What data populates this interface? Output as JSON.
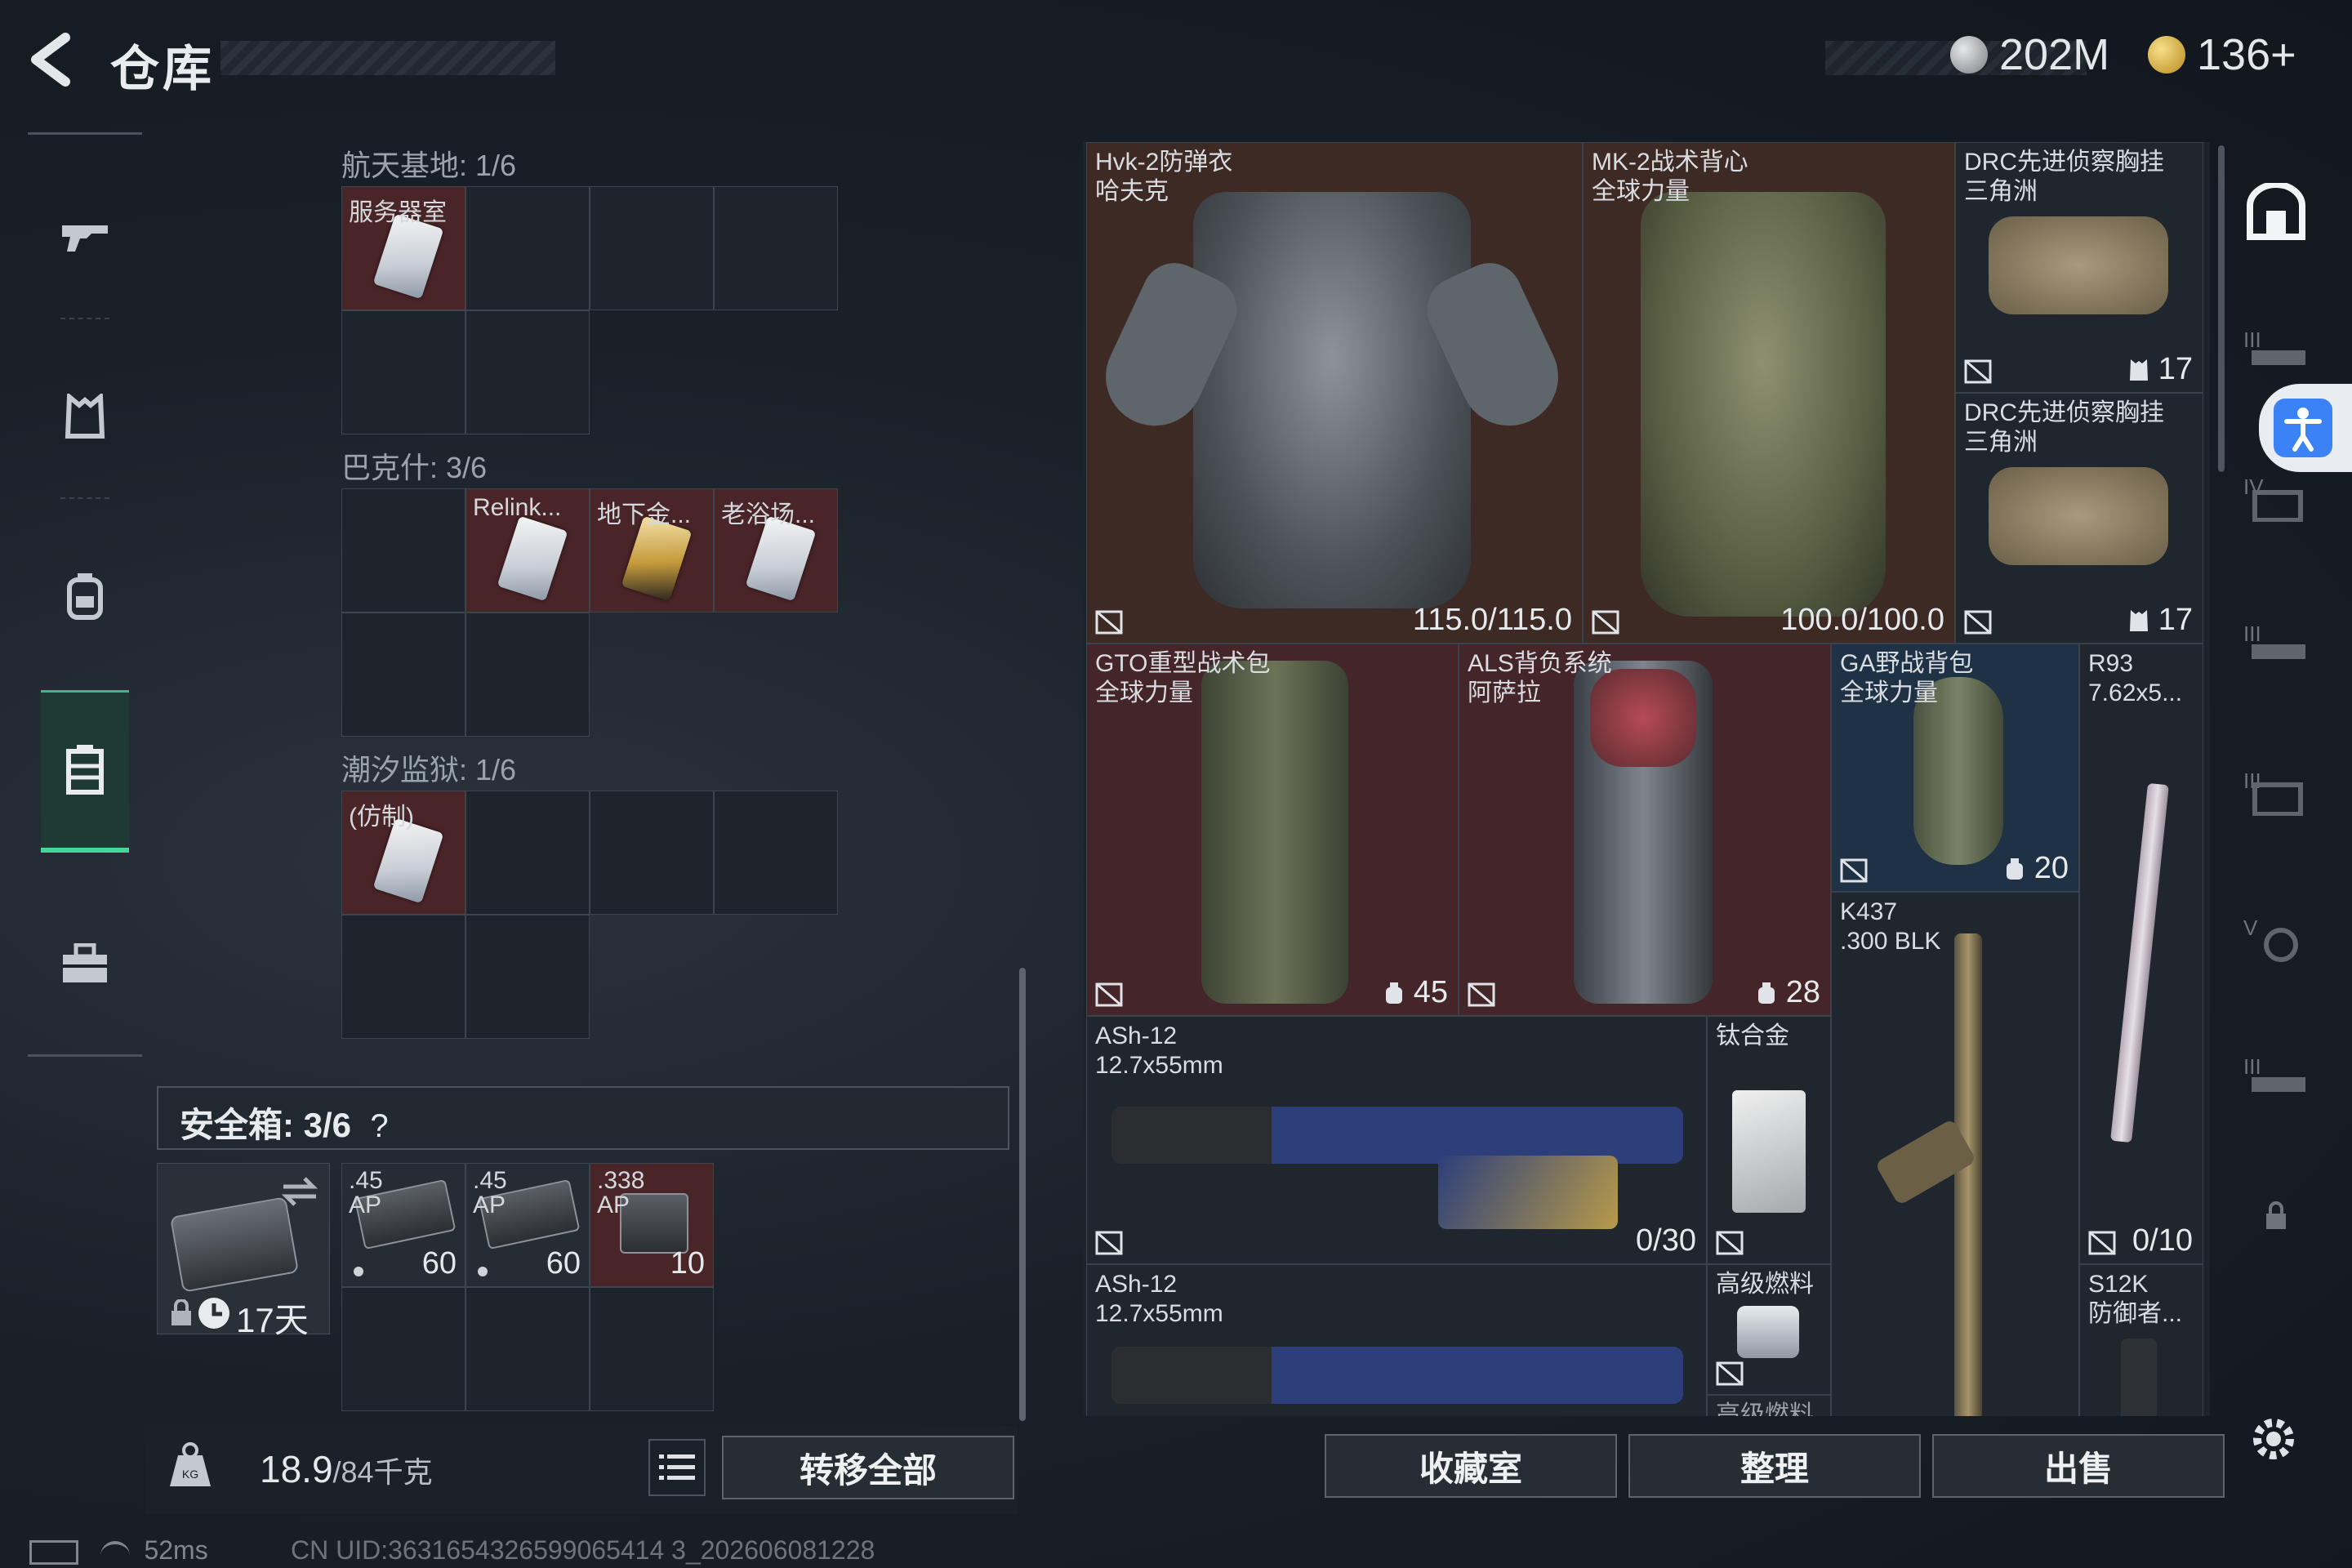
{
  "header": {
    "title": "仓库",
    "currency1": "202M",
    "currency2": "136+"
  },
  "left_nav": {
    "items": [
      "weapons",
      "armor",
      "backpack",
      "storage",
      "supplies"
    ],
    "active": "storage"
  },
  "maps": [
    {
      "name": "航天基地: 1/6",
      "cards": [
        {
          "label": "服务器室",
          "color": "white"
        }
      ]
    },
    {
      "name": "巴克什: 3/6",
      "cards": [
        {
          "label": "Relink...",
          "color": "white"
        },
        {
          "label": "地下金...",
          "color": "gold"
        },
        {
          "label": "老浴场...",
          "color": "white"
        }
      ]
    },
    {
      "name": "潮汐监狱: 1/6",
      "cards": [
        {
          "label": "(仿制)",
          "color": "white"
        }
      ]
    }
  ],
  "safe": {
    "label": "安全箱: 3/6",
    "help": "?",
    "timer": "17天",
    "ammo": [
      {
        "caliber": ".45\nAP",
        "count": "60"
      },
      {
        "caliber": ".45\nAP",
        "count": "60"
      },
      {
        "caliber": ".338\nAP",
        "count": "10"
      }
    ]
  },
  "bottom_left": {
    "weight_current": "18.9",
    "weight_max": "/84千克",
    "transfer_label": "转移全部"
  },
  "items": [
    {
      "id": "hvk",
      "label": "Hvk-2防弹衣\n哈夫克",
      "value": "115.0/115.0"
    },
    {
      "id": "mk2",
      "label": "MK-2战术背心\n全球力量",
      "value": "100.0/100.0"
    },
    {
      "id": "drc1",
      "label": "DRC先进侦察胸挂\n三角洲",
      "value": "17"
    },
    {
      "id": "drc2",
      "label": "DRC先进侦察胸挂\n三角洲",
      "value": "17"
    },
    {
      "id": "gto",
      "label": "GTO重型战术包\n全球力量",
      "value": "45"
    },
    {
      "id": "als",
      "label": "ALS背负系统\n阿萨拉",
      "value": "28"
    },
    {
      "id": "ga",
      "label": "GA野战背包\n全球力量",
      "value": "20"
    },
    {
      "id": "r93",
      "label": "R93\n7.62x5...",
      "value": "0/10"
    },
    {
      "id": "k437",
      "label": "K437\n.300 BLK",
      "value": ""
    },
    {
      "id": "ash1",
      "label": "ASh-12\n12.7x55mm",
      "value": "0/30"
    },
    {
      "id": "ti",
      "label": "钛合金",
      "value": ""
    },
    {
      "id": "ash2",
      "label": "ASh-12\n12.7x55mm",
      "value": ""
    },
    {
      "id": "fuel",
      "label": "高级燃料",
      "value": ""
    },
    {
      "id": "fuel2",
      "label": "高级燃料",
      "value": ""
    },
    {
      "id": "s12k",
      "label": "S12K\n防御者...",
      "value": ""
    }
  ],
  "bottom_right": {
    "btn1": "收藏室",
    "btn2": "整理",
    "btn3": "出售"
  },
  "status": {
    "ping": "52ms",
    "uid": "CN UID:3631654326599065414 3_202606081228"
  },
  "colors": {
    "accent_green": "#45d59d",
    "red_tile": "#44252a",
    "brown_tile": "#3e2a24",
    "blue_tile": "#1f3245",
    "access_blue": "#3b82f6"
  }
}
